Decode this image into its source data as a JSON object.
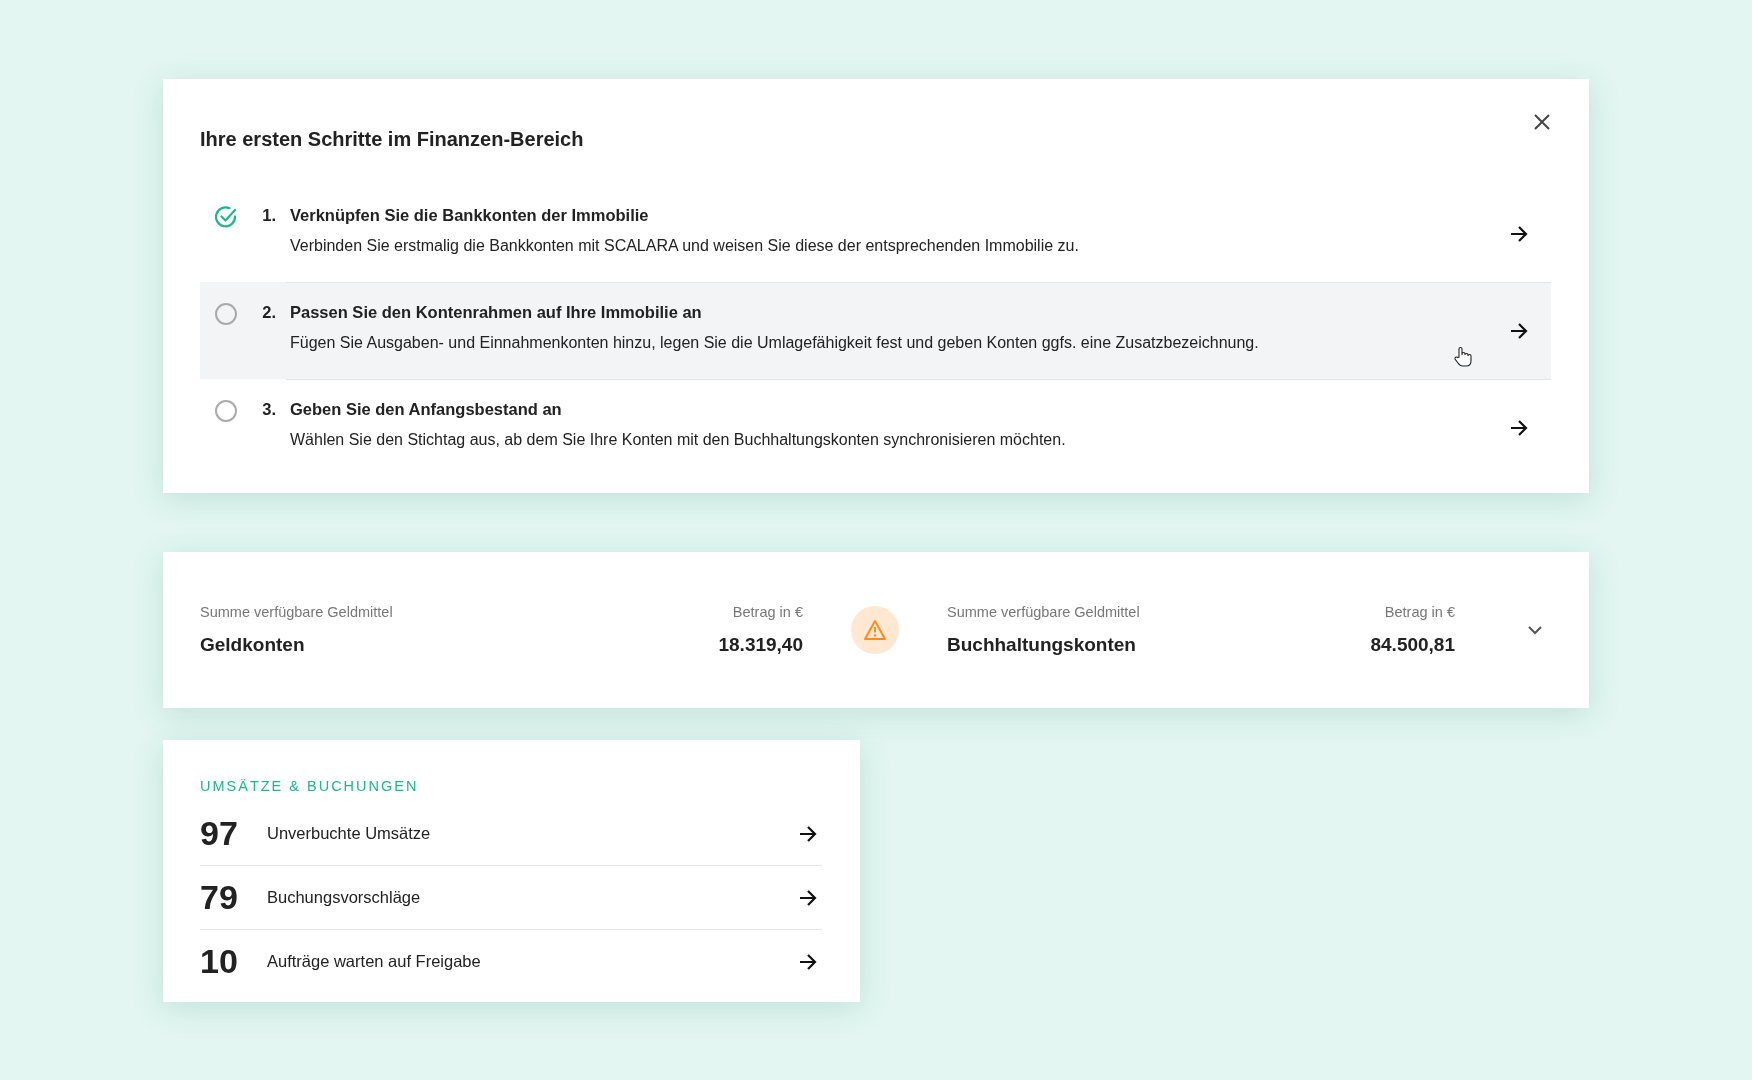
{
  "onboarding": {
    "title": "Ihre ersten Schritte im Finanzen-Bereich",
    "steps": [
      {
        "number": "1.",
        "title": "Verknüpfen Sie die Bankkonten der Immobilie",
        "description": "Verbinden Sie erstmalig die Bankkonten mit SCALARA und weisen Sie diese der entsprechenden Immobilie zu.",
        "checked": true,
        "hovered": false
      },
      {
        "number": "2.",
        "title": "Passen Sie den Kontenrahmen auf Ihre Immobilie an",
        "description": "Fügen Sie Ausgaben- und Einnahmenkonten hinzu, legen Sie die Umlagefähigkeit fest und geben Konten ggfs. eine Zusatzbezeichnung.",
        "checked": false,
        "hovered": true
      },
      {
        "number": "3.",
        "title": "Geben Sie den Anfangsbestand an",
        "description": "Wählen Sie den Stichtag aus, ab dem Sie Ihre Konten mit den Buchhaltungskonten synchronisieren möchten.",
        "checked": false,
        "hovered": false
      }
    ]
  },
  "balances": {
    "warning": true,
    "accounts": [
      {
        "label": "Summe verfügbare Geldmittel",
        "name": "Geldkonten",
        "amount_label": "Betrag in €",
        "amount": "18.319,40"
      },
      {
        "label": "Summe verfügbare Geldmittel",
        "name": "Buchhaltungskonten",
        "amount_label": "Betrag in €",
        "amount": "84.500,81"
      }
    ]
  },
  "transactions": {
    "heading": "UMSÄTZE & BUCHUNGEN",
    "items": [
      {
        "count": "97",
        "label": "Unverbuchte Umsätze"
      },
      {
        "count": "79",
        "label": "Buchungsvorschläge"
      },
      {
        "count": "10",
        "label": "Aufträge warten auf Freigabe"
      }
    ]
  }
}
